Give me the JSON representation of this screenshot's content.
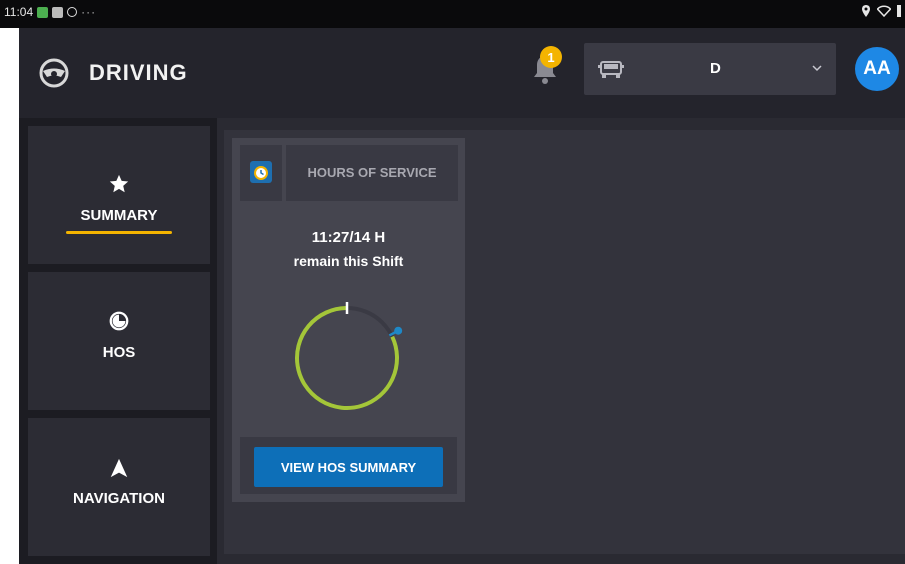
{
  "status_bar": {
    "time": "11:04",
    "more": "···"
  },
  "header": {
    "title": "DRIVING",
    "notification_count": "1",
    "vehicle_select": {
      "selected": "D"
    },
    "avatar_initials": "AA"
  },
  "sidebar": {
    "items": [
      {
        "label": "SUMMARY",
        "icon": "star-icon",
        "active": true
      },
      {
        "label": "HOS",
        "icon": "clock-icon",
        "active": false
      },
      {
        "label": "NAVIGATION",
        "icon": "navigation-arrow-icon",
        "active": false
      }
    ]
  },
  "hos_card": {
    "title": "HOURS OF SERVICE",
    "remaining": "11:27/14  H",
    "remaining_label": "remain this Shift",
    "button_label": "VIEW HOS SUMMARY",
    "progress_used_fraction": 0.18
  },
  "colors": {
    "accent_yellow": "#f4b400",
    "progress_green": "#a4c639",
    "progress_blue": "#1e88c7",
    "button_blue": "#0d6fb8",
    "avatar_blue": "#1e88e5"
  }
}
